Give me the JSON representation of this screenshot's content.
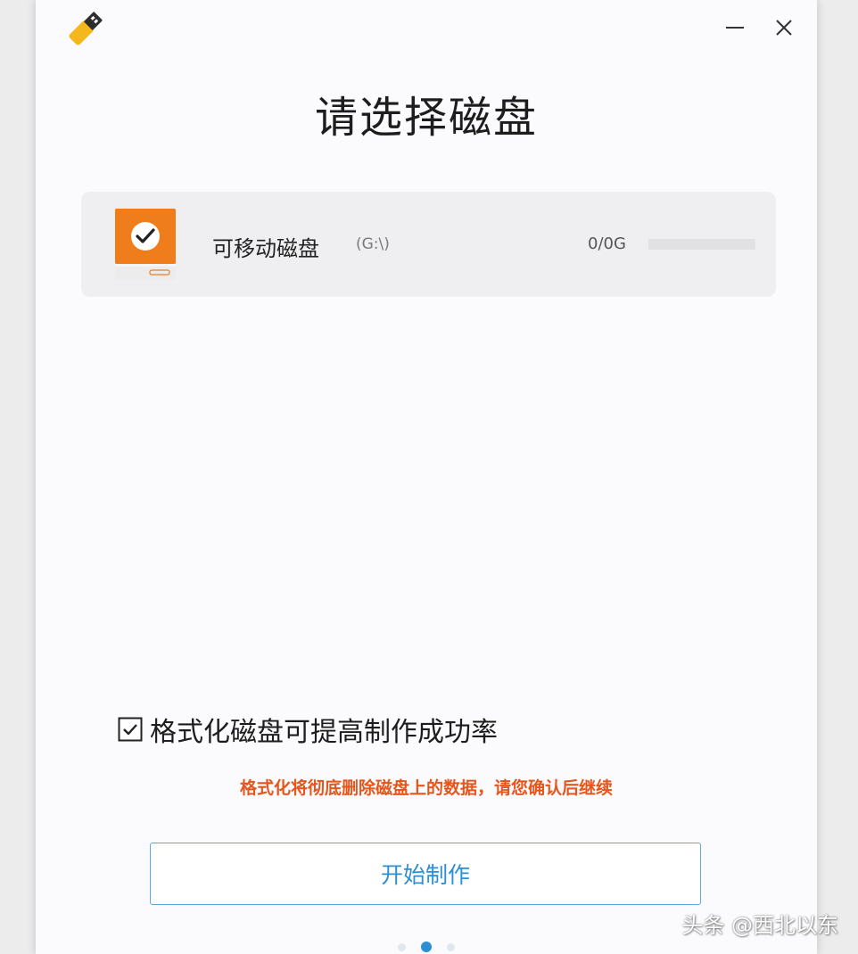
{
  "window": {
    "title": "请选择磁盘",
    "app_icon": "usb-drive-icon",
    "minimize_icon": "minimize-icon",
    "close_icon": "close-icon"
  },
  "disk": {
    "name": "可移动磁盘",
    "path": "(G:\\)",
    "size": "0/0G",
    "usage_fraction": 0,
    "icon": "disk-selected-check-icon",
    "selected": true
  },
  "format_option": {
    "label": "格式化磁盘可提高制作成功率",
    "checked": true,
    "warning": "格式化将彻底删除磁盘上的数据，请您确认后继续"
  },
  "start_button": {
    "label": "开始制作"
  },
  "pagination": {
    "current": 2,
    "total": 3
  },
  "watermark": "头条 @西北以东",
  "colors": {
    "accent": "#2b8fd6",
    "warning": "#e5561d",
    "disk_orange": "#f07d1c",
    "logo_yellow": "#f5b81c"
  }
}
